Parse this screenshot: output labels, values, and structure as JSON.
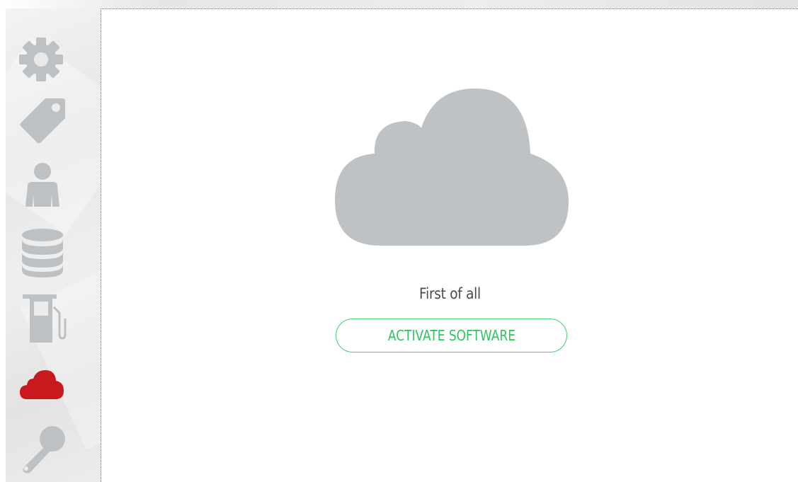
{
  "sidebar": {
    "items": [
      {
        "icon": "gear-icon",
        "color": "#bdc1c4"
      },
      {
        "icon": "tag-icon",
        "color": "#bdc1c4"
      },
      {
        "icon": "user-icon",
        "color": "#bdc1c4"
      },
      {
        "icon": "database-icon",
        "color": "#bdc1c4"
      },
      {
        "icon": "fuel-pump-icon",
        "color": "#bdc1c4"
      },
      {
        "icon": "cloud-icon",
        "color": "#c8191c",
        "active": true
      },
      {
        "icon": "key-icon",
        "color": "#bdc1c4"
      }
    ]
  },
  "main": {
    "hero_icon": "cloud-icon",
    "hero_color": "#bec2c5",
    "subtitle": "First of all",
    "activate_label": "ACTIVATE SOFTWARE",
    "accent_color": "#3fcf6b"
  }
}
